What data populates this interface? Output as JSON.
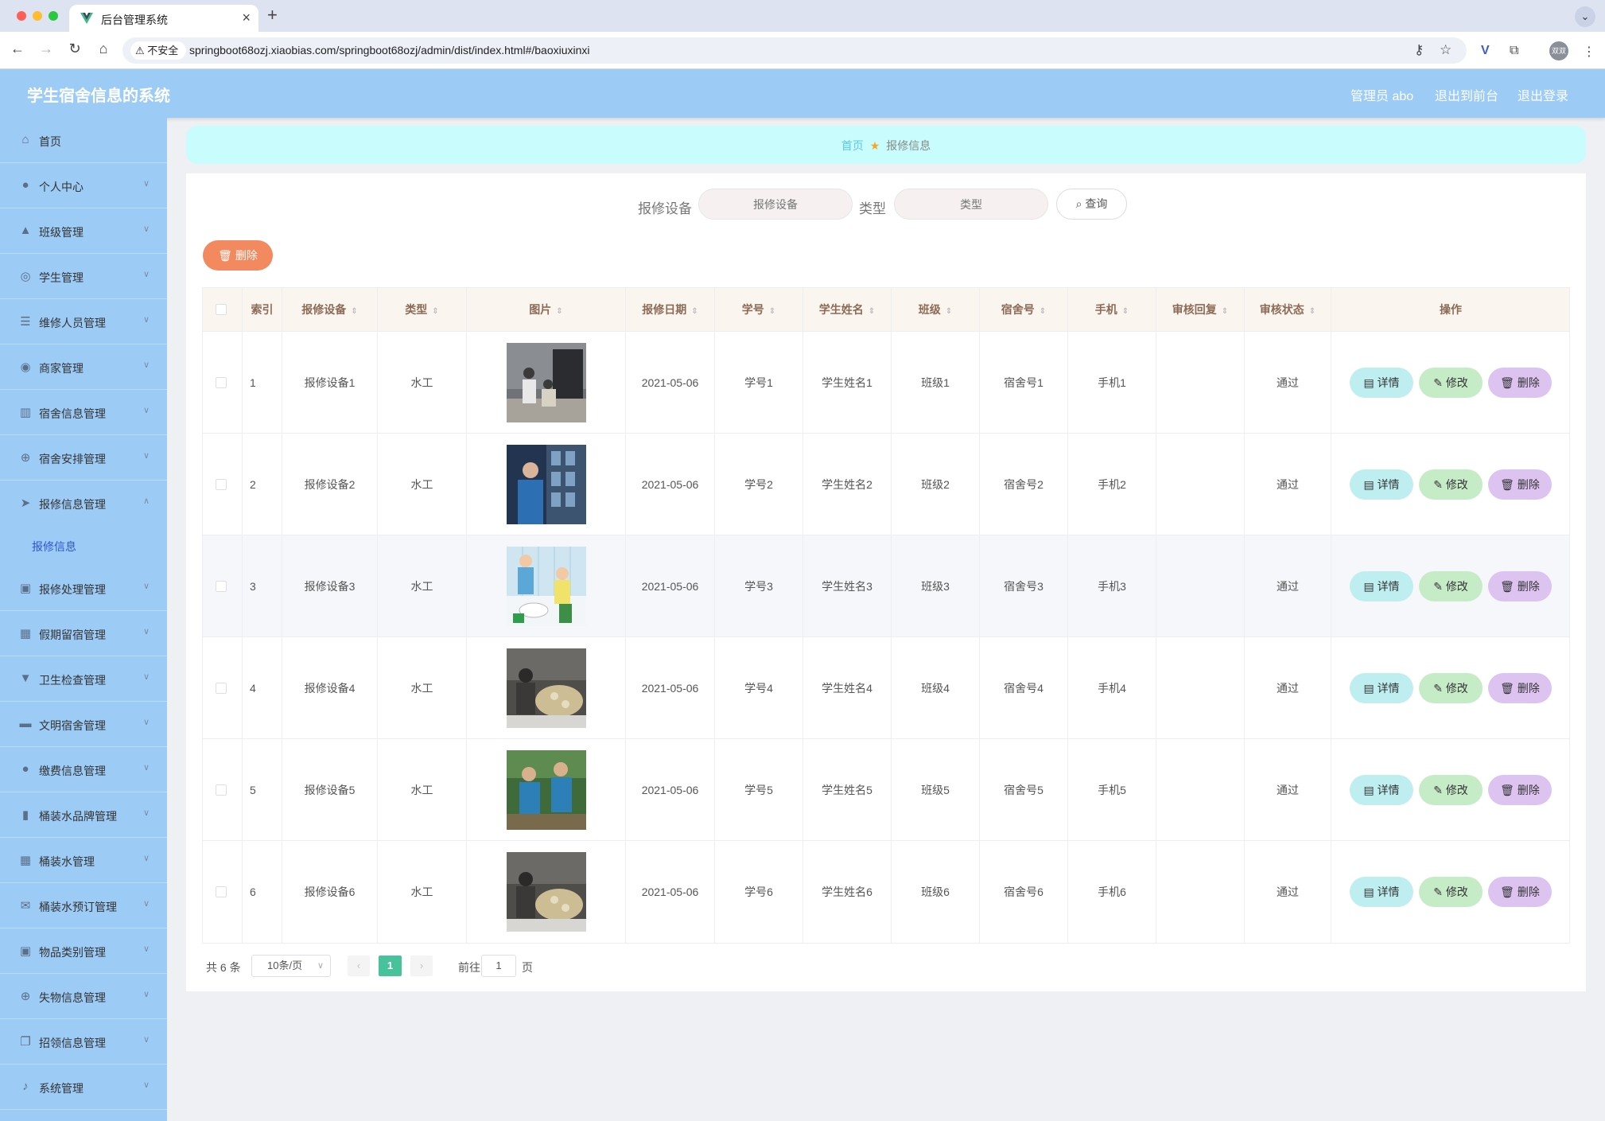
{
  "browser": {
    "tab_title": "后台管理系统",
    "insecure_label": "不安全",
    "url": "springboot68ozj.xiaobias.com/springboot68ozj/admin/dist/index.html#/baoxiuxinxi",
    "profile_label": "双双"
  },
  "header": {
    "title": "学生宿舍信息的系统",
    "admin_label": "管理员 abo",
    "front_link": "退出到前台",
    "logout_link": "退出登录"
  },
  "sidebar": {
    "items": [
      {
        "label": "首页",
        "icon": "home-icon"
      },
      {
        "label": "个人中心",
        "icon": "user-icon"
      },
      {
        "label": "班级管理",
        "icon": "class-icon"
      },
      {
        "label": "学生管理",
        "icon": "student-icon"
      },
      {
        "label": "维修人员管理",
        "icon": "sliders-icon"
      },
      {
        "label": "商家管理",
        "icon": "shop-icon"
      },
      {
        "label": "宿舍信息管理",
        "icon": "building-icon"
      },
      {
        "label": "宿舍安排管理",
        "icon": "compass-icon"
      },
      {
        "label": "报修信息管理",
        "icon": "send-icon"
      },
      {
        "label": "报修处理管理",
        "icon": "clipboard-icon"
      },
      {
        "label": "假期留宿管理",
        "icon": "grid-icon"
      },
      {
        "label": "卫生检查管理",
        "icon": "trophy-icon"
      },
      {
        "label": "文明宿舍管理",
        "icon": "monitor-icon"
      },
      {
        "label": "缴费信息管理",
        "icon": "user-icon"
      },
      {
        "label": "桶装水品牌管理",
        "icon": "bar-chart-icon"
      },
      {
        "label": "桶装水管理",
        "icon": "grid-icon"
      },
      {
        "label": "桶装水预订管理",
        "icon": "mail-icon"
      },
      {
        "label": "物品类别管理",
        "icon": "clipboard-icon"
      },
      {
        "label": "失物信息管理",
        "icon": "compass-icon"
      },
      {
        "label": "招领信息管理",
        "icon": "copy-icon"
      },
      {
        "label": "系统管理",
        "icon": "mic-icon"
      }
    ],
    "submenu_label": "报修信息"
  },
  "breadcrumb": {
    "home": "首页",
    "current": "报修信息"
  },
  "search": {
    "device_label": "报修设备",
    "device_placeholder": "报修设备",
    "type_label": "类型",
    "type_placeholder": "类型",
    "query_label": "查询"
  },
  "toolbar": {
    "batch_delete_label": "删除"
  },
  "table": {
    "headers": {
      "index": "索引",
      "device": "报修设备",
      "type": "类型",
      "image": "图片",
      "date": "报修日期",
      "student_no": "学号",
      "student_name": "学生姓名",
      "class": "班级",
      "dorm": "宿舍号",
      "phone": "手机",
      "reply": "审核回复",
      "status": "审核状态",
      "ops": "操作"
    },
    "rows": [
      {
        "index": "1",
        "device": "报修设备1",
        "type": "水工",
        "date": "2021-05-06",
        "student_no": "学号1",
        "student_name": "学生姓名1",
        "class": "班级1",
        "dorm": "宿舍号1",
        "phone": "手机1",
        "reply": "",
        "status": "通过"
      },
      {
        "index": "2",
        "device": "报修设备2",
        "type": "水工",
        "date": "2021-05-06",
        "student_no": "学号2",
        "student_name": "学生姓名2",
        "class": "班级2",
        "dorm": "宿舍号2",
        "phone": "手机2",
        "reply": "",
        "status": "通过"
      },
      {
        "index": "3",
        "device": "报修设备3",
        "type": "水工",
        "date": "2021-05-06",
        "student_no": "学号3",
        "student_name": "学生姓名3",
        "class": "班级3",
        "dorm": "宿舍号3",
        "phone": "手机3",
        "reply": "",
        "status": "通过"
      },
      {
        "index": "4",
        "device": "报修设备4",
        "type": "水工",
        "date": "2021-05-06",
        "student_no": "学号4",
        "student_name": "学生姓名4",
        "class": "班级4",
        "dorm": "宿舍号4",
        "phone": "手机4",
        "reply": "",
        "status": "通过"
      },
      {
        "index": "5",
        "device": "报修设备5",
        "type": "水工",
        "date": "2021-05-06",
        "student_no": "学号5",
        "student_name": "学生姓名5",
        "class": "班级5",
        "dorm": "宿舍号5",
        "phone": "手机5",
        "reply": "",
        "status": "通过"
      },
      {
        "index": "6",
        "device": "报修设备6",
        "type": "水工",
        "date": "2021-05-06",
        "student_no": "学号6",
        "student_name": "学生姓名6",
        "class": "班级6",
        "dorm": "宿舍号6",
        "phone": "手机6",
        "reply": "",
        "status": "通过"
      }
    ],
    "ops": {
      "detail": "详情",
      "edit": "修改",
      "delete": "删除"
    }
  },
  "pagination": {
    "total_text": "共 6 条",
    "page_size": "10条/页",
    "current_page": "1",
    "goto_prefix": "前往",
    "goto_value": "1",
    "goto_suffix": "页"
  },
  "colors": {
    "header_bg": "#9ccbf6",
    "breadcrumb_bg": "#c9fcfd",
    "batch_delete": "#f3895f",
    "detail_btn": "#bfeef0",
    "edit_btn": "#c6ecc7",
    "delete_btn": "#dcc3f0",
    "pager_active": "#47c29a"
  }
}
